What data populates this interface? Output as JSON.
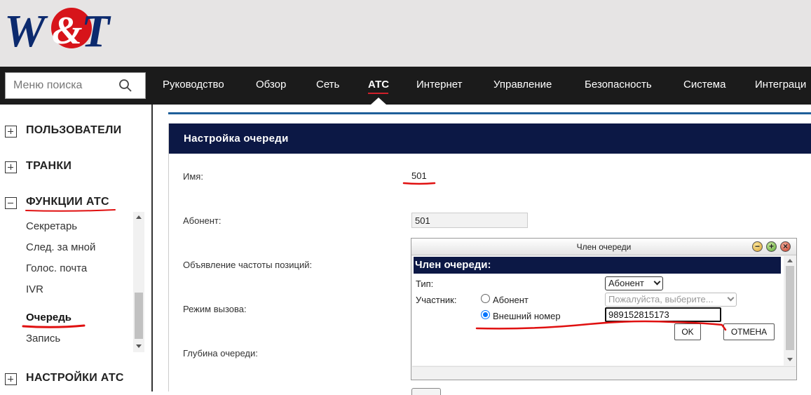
{
  "brand": {
    "logo_text": "W&T",
    "red": "#d7141a",
    "navy": "#0c2a6e"
  },
  "search": {
    "placeholder": "Меню поиска",
    "value": ""
  },
  "nav": {
    "items": [
      "Руководство",
      "Обзор",
      "Сеть",
      "АТС",
      "Интернет",
      "Управление",
      "Безопасность",
      "Система",
      "Интеграци"
    ],
    "active": "АТС"
  },
  "sidebar": {
    "sections": [
      {
        "label": "ПОЛЬЗОВАТЕЛИ",
        "state": "collapsed"
      },
      {
        "label": "ТРАНКИ",
        "state": "collapsed"
      },
      {
        "label": "ФУНКЦИИ АТС",
        "state": "expanded",
        "items": [
          "Секретарь",
          "След. за мной",
          "Голос. почта",
          "IVR",
          "Очередь",
          "Запись"
        ],
        "active_item": "Очередь"
      },
      {
        "label": "НАСТРОЙКИ АТС",
        "state": "collapsed"
      }
    ]
  },
  "main": {
    "panel_title": "Настройка очереди",
    "fields": {
      "name_label": "Имя:",
      "name_value": "501",
      "subscriber_label": "Абонент:",
      "subscriber_value": "501",
      "announce_label": "Объявление частоты позиций:",
      "call_mode_label": "Режим вызова:",
      "depth_label": "Глубина очереди:"
    }
  },
  "dialog": {
    "window_title": "Член очереди",
    "header": "Член очереди:",
    "type_label": "Тип:",
    "type_value": "Абонент",
    "participant_label": "Участник:",
    "radio_subscriber": "Абонент",
    "subscriber_select_placeholder": "Пожалуйста, выберите...",
    "radio_external": "Внешний номер",
    "external_value": "989152815173",
    "selected_radio": "external",
    "ok_label": "OK",
    "cancel_label": "ОТМЕНА"
  },
  "colors": {
    "nav_bg": "#1b1b1b",
    "panel_header": "#0c1845",
    "header_bg": "#e6e4e4",
    "annotation": "#e01010",
    "radio_accent": "#0075ff"
  }
}
